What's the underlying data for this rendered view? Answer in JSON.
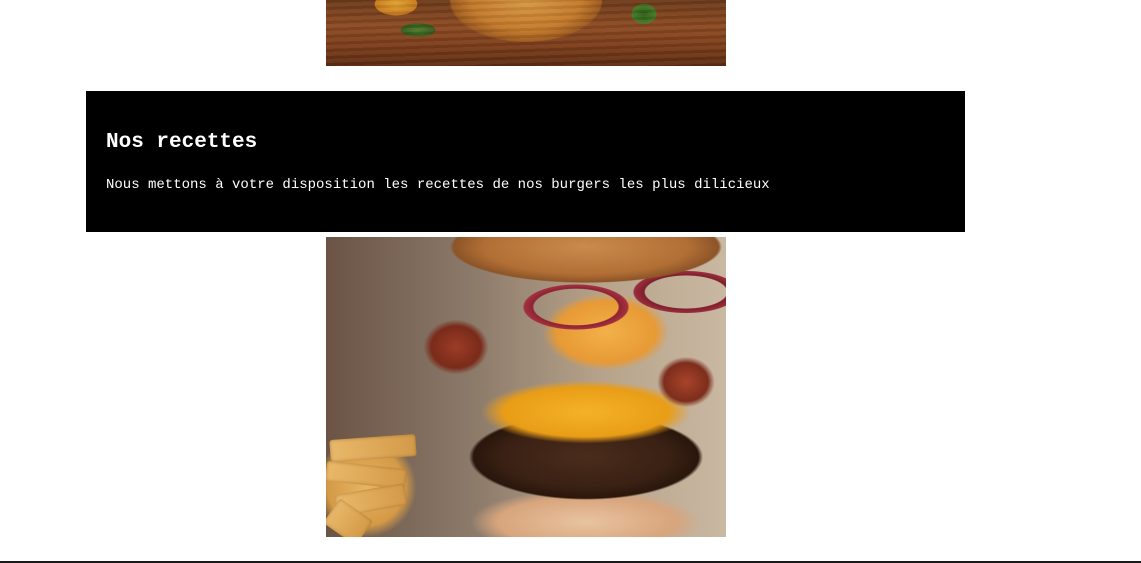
{
  "recipes": {
    "title": "Nos recettes",
    "description": "Nous mettons à votre disposition les recettes de nos burgers les plus dilicieux"
  },
  "images": {
    "top": "burger-photo",
    "bottom": "bacon-cheeseburger-photo"
  },
  "colors": {
    "block_background": "#000000",
    "block_text": "#ffffff",
    "page_background": "#ffffff"
  }
}
